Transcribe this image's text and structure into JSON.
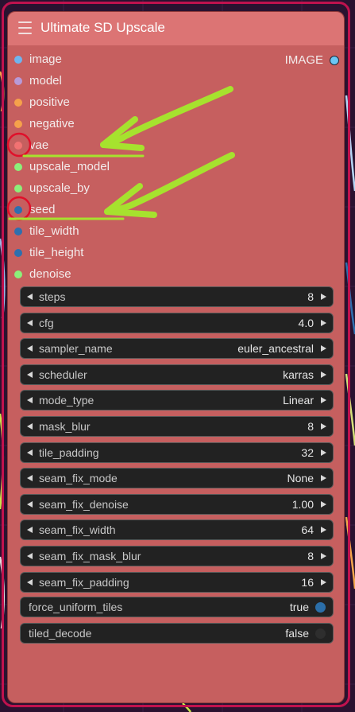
{
  "node": {
    "title": "Ultimate SD Upscale",
    "output": {
      "label": "IMAGE",
      "icon": "output-connector-dot"
    },
    "inputs": [
      {
        "label": "image",
        "color": "#6fb4ee"
      },
      {
        "label": "model",
        "color": "#b89ad8"
      },
      {
        "label": "positive",
        "color": "#f6a14b"
      },
      {
        "label": "negative",
        "color": "#f6a14b"
      },
      {
        "label": "vae",
        "color": "#f27272"
      },
      {
        "label": "upscale_model",
        "color": "#8cf07a"
      },
      {
        "label": "upscale_by",
        "color": "#8cf07a"
      },
      {
        "label": "seed",
        "color": "#2e6fae"
      },
      {
        "label": "tile_width",
        "color": "#2e6fae"
      },
      {
        "label": "tile_height",
        "color": "#2e6fae"
      },
      {
        "label": "denoise",
        "color": "#8cf07a"
      }
    ],
    "widgets": [
      {
        "name": "steps",
        "value": "8"
      },
      {
        "name": "cfg",
        "value": "4.0"
      },
      {
        "name": "sampler_name",
        "value": "euler_ancestral"
      },
      {
        "name": "scheduler",
        "value": "karras"
      },
      {
        "name": "mode_type",
        "value": "Linear"
      },
      {
        "name": "mask_blur",
        "value": "8"
      },
      {
        "name": "tile_padding",
        "value": "32"
      },
      {
        "name": "seam_fix_mode",
        "value": "None"
      },
      {
        "name": "seam_fix_denoise",
        "value": "1.00"
      },
      {
        "name": "seam_fix_width",
        "value": "64"
      },
      {
        "name": "seam_fix_mask_blur",
        "value": "8"
      },
      {
        "name": "seam_fix_padding",
        "value": "16"
      }
    ],
    "toggles": [
      {
        "name": "force_uniform_tiles",
        "value": "true",
        "dot_color": "#2b6ea8"
      },
      {
        "name": "tiled_decode",
        "value": "false",
        "dot_color": "#2e2e2e"
      }
    ]
  },
  "annotations": {
    "arrow_color": "#a6e22e",
    "circle_color": "#e0102a",
    "highlighted_inputs": [
      "vae",
      "seed"
    ]
  },
  "colors": {
    "node_body": "#c65f5f",
    "node_title": "#dc7474",
    "frame": "#c0124e",
    "widget_bg": "#222222"
  }
}
